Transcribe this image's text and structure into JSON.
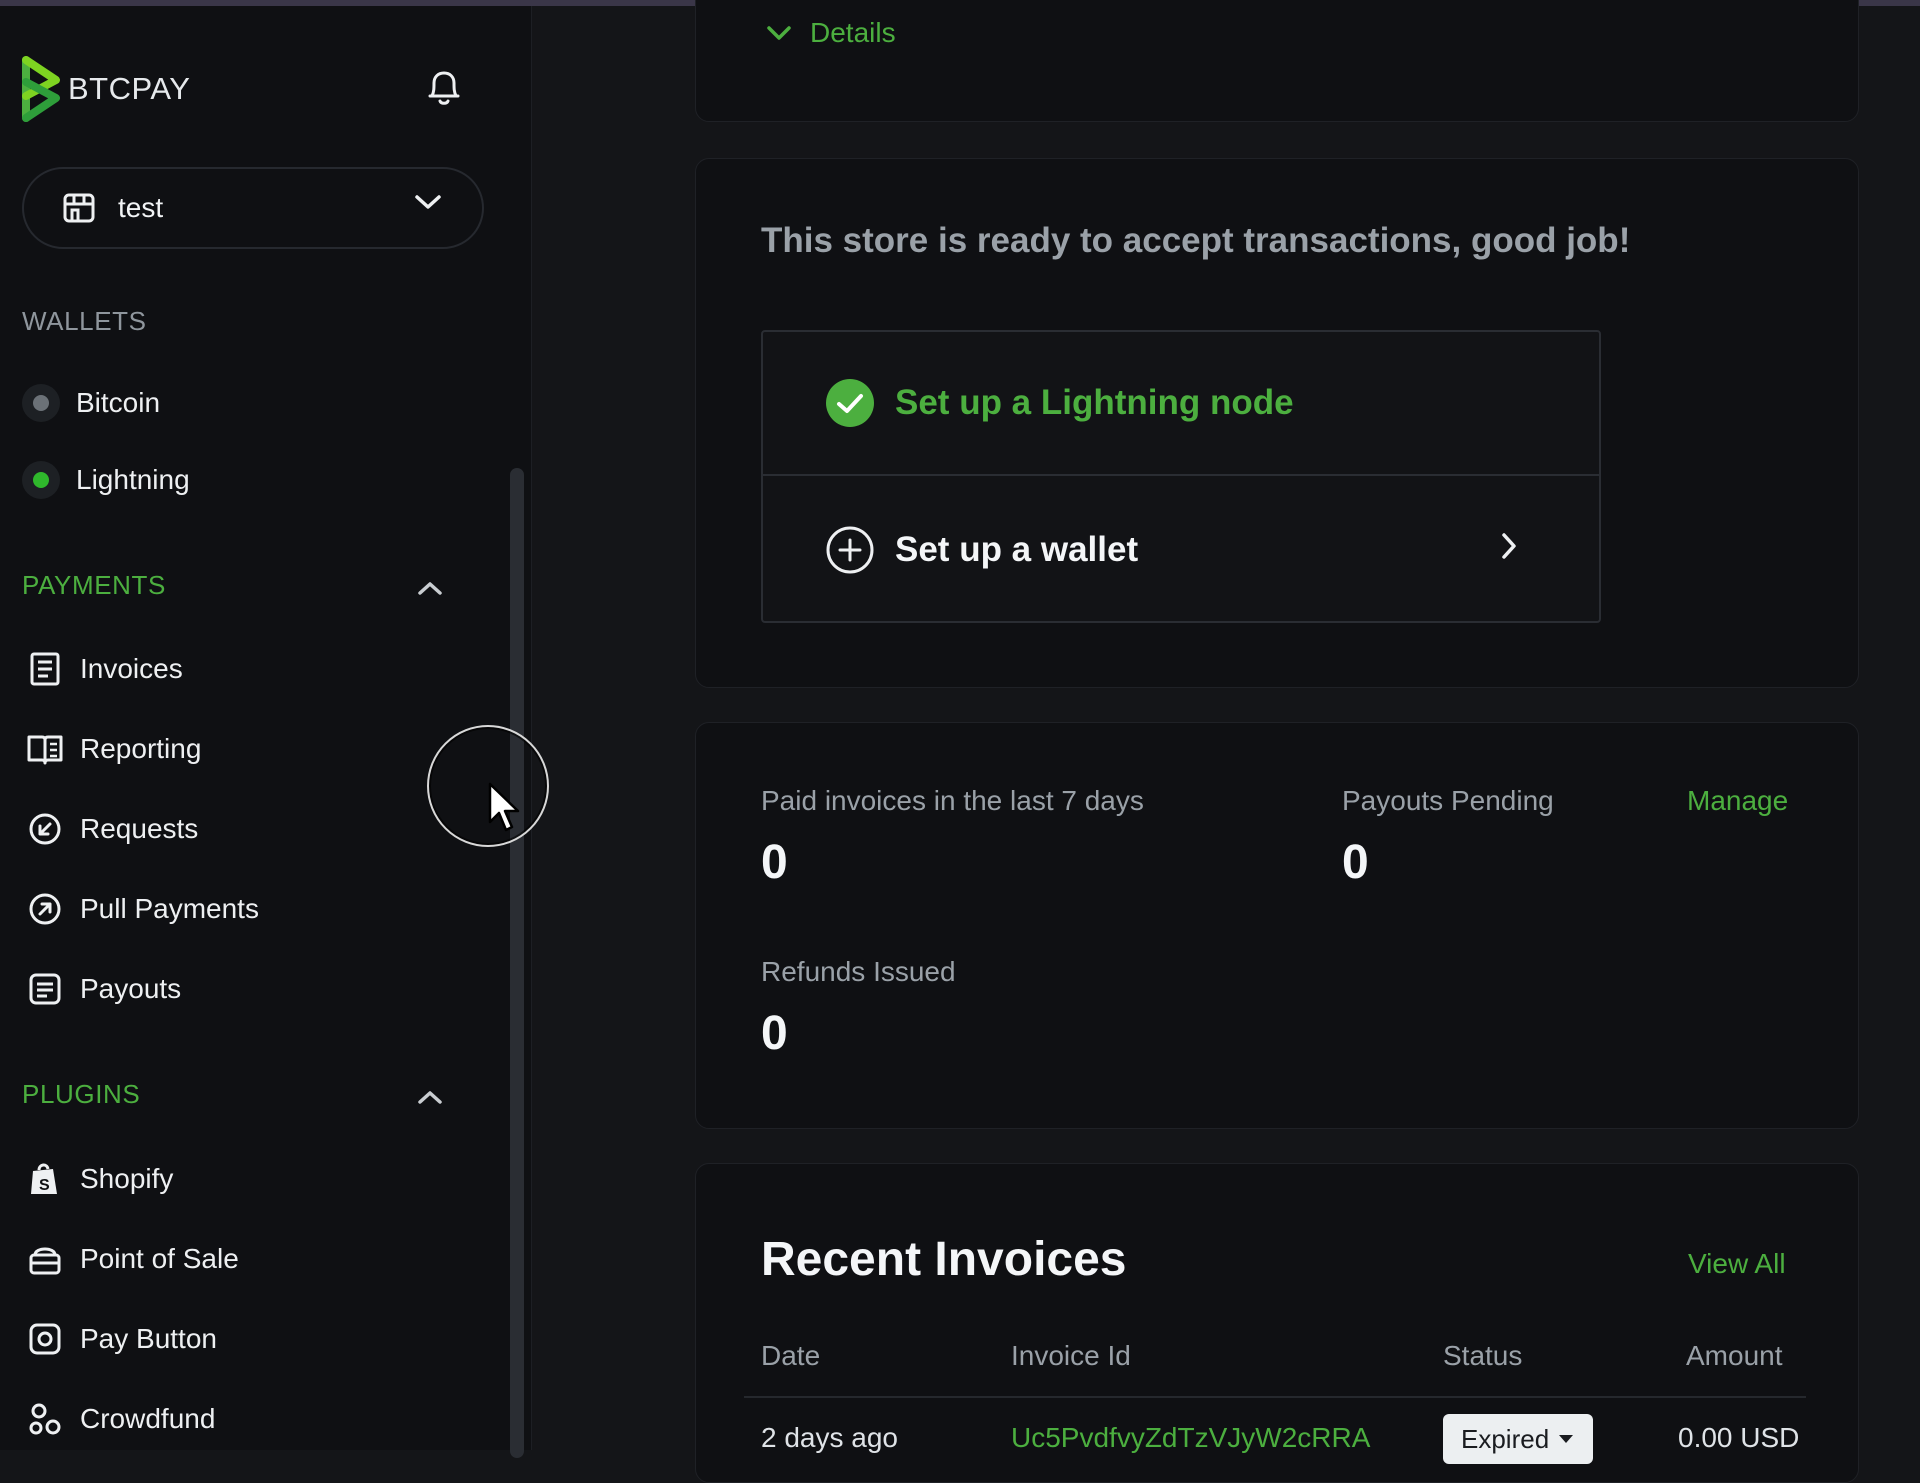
{
  "brand": {
    "logo_text": "BTCPAY"
  },
  "store_selector": {
    "selected": "test"
  },
  "sidebar": {
    "wallets_heading": "WALLETS",
    "wallets": [
      {
        "label": "Bitcoin",
        "status_color": "#6b7177"
      },
      {
        "label": "Lightning",
        "status_color": "#2fb82c"
      }
    ],
    "payments_heading": "PAYMENTS",
    "payments": [
      {
        "label": "Invoices",
        "icon": "invoice-icon"
      },
      {
        "label": "Reporting",
        "icon": "reporting-icon"
      },
      {
        "label": "Requests",
        "icon": "request-icon"
      },
      {
        "label": "Pull Payments",
        "icon": "pull-payment-icon"
      },
      {
        "label": "Payouts",
        "icon": "payout-icon"
      }
    ],
    "plugins_heading": "PLUGINS",
    "plugins": [
      {
        "label": "Shopify",
        "icon": "shopify-icon"
      },
      {
        "label": "Point of Sale",
        "icon": "pos-icon"
      },
      {
        "label": "Pay Button",
        "icon": "pay-button-icon"
      },
      {
        "label": "Crowdfund",
        "icon": "crowdfund-icon"
      }
    ]
  },
  "details": {
    "label": "Details"
  },
  "setup": {
    "title": "This store is ready to accept transactions, good job!",
    "lightning": "Set up a Lightning node",
    "wallet": "Set up a wallet"
  },
  "stats": {
    "paid_label": "Paid invoices in the last 7 days",
    "paid_value": "0",
    "payouts_label": "Payouts Pending",
    "payouts_value": "0",
    "manage": "Manage",
    "refunds_label": "Refunds Issued",
    "refunds_value": "0"
  },
  "recent_invoices": {
    "title": "Recent Invoices",
    "view_all": "View All",
    "headers": {
      "date": "Date",
      "invoice_id": "Invoice Id",
      "status": "Status",
      "amount": "Amount"
    },
    "rows": [
      {
        "date": "2 days ago",
        "invoice_id": "Uc5PvdfvyZdTzVJyW2cRRA",
        "status": "Expired",
        "amount": "0.00 USD"
      }
    ]
  },
  "colors": {
    "accent": "#4caf3f",
    "background": "#141518",
    "sidebar": "#0f1013"
  }
}
